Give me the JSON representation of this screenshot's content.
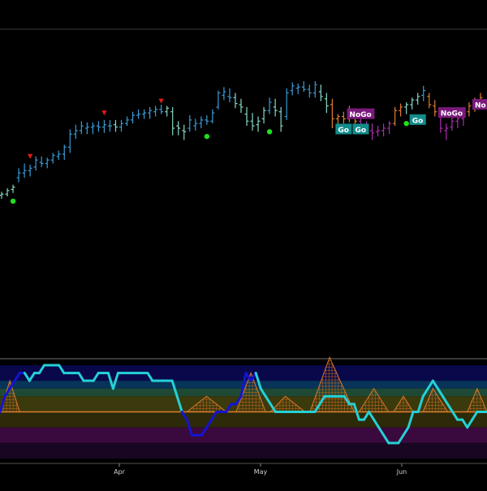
{
  "chart_data": [
    {
      "type": "ohlc",
      "title": "",
      "ylim": [
        0,
        100
      ],
      "colors": {
        "strong_go": "#3a9bd5",
        "weak_go": "#86d9c6",
        "weak_nogo": "#e07c2f",
        "strong_nogo": "#b02ab5",
        "neutral": "#d9d9d9"
      },
      "bars": [
        {
          "x": 0,
          "o": 3,
          "h": 6,
          "l": 0,
          "c": 4,
          "s": "weak_go"
        },
        {
          "x": 1,
          "o": 4,
          "h": 9,
          "l": 2,
          "c": 7,
          "s": "weak_go"
        },
        {
          "x": 2,
          "o": 8,
          "h": 12,
          "l": 5,
          "c": 10,
          "s": "weak_go"
        },
        {
          "x": 3,
          "o": 18,
          "h": 26,
          "l": 14,
          "c": 22,
          "s": "strong_go"
        },
        {
          "x": 4,
          "o": 22,
          "h": 30,
          "l": 18,
          "c": 24,
          "s": "strong_go"
        },
        {
          "x": 5,
          "o": 24,
          "h": 29,
          "l": 19,
          "c": 26,
          "s": "strong_go"
        },
        {
          "x": 6,
          "o": 27,
          "h": 36,
          "l": 24,
          "c": 33,
          "s": "strong_go"
        },
        {
          "x": 7,
          "o": 31,
          "h": 36,
          "l": 27,
          "c": 30,
          "s": "strong_go"
        },
        {
          "x": 8,
          "o": 30,
          "h": 35,
          "l": 26,
          "c": 33,
          "s": "strong_go"
        },
        {
          "x": 9,
          "o": 33,
          "h": 39,
          "l": 30,
          "c": 37,
          "s": "strong_go"
        },
        {
          "x": 10,
          "o": 36,
          "h": 41,
          "l": 33,
          "c": 38,
          "s": "strong_go"
        },
        {
          "x": 11,
          "o": 38,
          "h": 46,
          "l": 33,
          "c": 44,
          "s": "strong_go"
        },
        {
          "x": 12,
          "o": 44,
          "h": 59,
          "l": 39,
          "c": 55,
          "s": "strong_go"
        },
        {
          "x": 13,
          "o": 55,
          "h": 63,
          "l": 51,
          "c": 58,
          "s": "strong_go"
        },
        {
          "x": 14,
          "o": 58,
          "h": 66,
          "l": 55,
          "c": 62,
          "s": "strong_go"
        },
        {
          "x": 15,
          "o": 60,
          "h": 65,
          "l": 55,
          "c": 61,
          "s": "strong_go"
        },
        {
          "x": 16,
          "o": 61,
          "h": 65,
          "l": 55,
          "c": 62,
          "s": "strong_go"
        },
        {
          "x": 17,
          "o": 62,
          "h": 66,
          "l": 57,
          "c": 61,
          "s": "strong_go"
        },
        {
          "x": 18,
          "o": 61,
          "h": 67,
          "l": 56,
          "c": 63,
          "s": "strong_go"
        },
        {
          "x": 19,
          "o": 62,
          "h": 67,
          "l": 57,
          "c": 62,
          "s": "strong_go"
        },
        {
          "x": 20,
          "o": 63,
          "h": 67,
          "l": 57,
          "c": 61,
          "s": "weak_go"
        },
        {
          "x": 21,
          "o": 61,
          "h": 67,
          "l": 57,
          "c": 64,
          "s": "strong_go"
        },
        {
          "x": 22,
          "o": 64,
          "h": 70,
          "l": 62,
          "c": 67,
          "s": "strong_go"
        },
        {
          "x": 23,
          "o": 67,
          "h": 74,
          "l": 64,
          "c": 71,
          "s": "strong_go"
        },
        {
          "x": 24,
          "o": 71,
          "h": 76,
          "l": 68,
          "c": 72,
          "s": "strong_go"
        },
        {
          "x": 25,
          "o": 72,
          "h": 76,
          "l": 68,
          "c": 73,
          "s": "strong_go"
        },
        {
          "x": 26,
          "o": 73,
          "h": 78,
          "l": 68,
          "c": 75,
          "s": "strong_go"
        },
        {
          "x": 27,
          "o": 74,
          "h": 79,
          "l": 70,
          "c": 76,
          "s": "strong_go"
        },
        {
          "x": 28,
          "o": 76,
          "h": 80,
          "l": 72,
          "c": 74,
          "s": "strong_go"
        },
        {
          "x": 29,
          "o": 74,
          "h": 79,
          "l": 70,
          "c": 77,
          "s": "weak_go"
        },
        {
          "x": 30,
          "o": 74,
          "h": 78,
          "l": 54,
          "c": 60,
          "s": "weak_go"
        },
        {
          "x": 31,
          "o": 62,
          "h": 66,
          "l": 54,
          "c": 60,
          "s": "weak_go"
        },
        {
          "x": 32,
          "o": 58,
          "h": 63,
          "l": 50,
          "c": 57,
          "s": "weak_go"
        },
        {
          "x": 33,
          "o": 60,
          "h": 71,
          "l": 57,
          "c": 67,
          "s": "strong_go"
        },
        {
          "x": 34,
          "o": 62,
          "h": 68,
          "l": 58,
          "c": 64,
          "s": "strong_go"
        },
        {
          "x": 35,
          "o": 64,
          "h": 70,
          "l": 60,
          "c": 67,
          "s": "strong_go"
        },
        {
          "x": 36,
          "o": 67,
          "h": 71,
          "l": 63,
          "c": 66,
          "s": "strong_go"
        },
        {
          "x": 37,
          "o": 66,
          "h": 76,
          "l": 64,
          "c": 73,
          "s": "strong_go"
        },
        {
          "x": 38,
          "o": 78,
          "h": 92,
          "l": 76,
          "c": 90,
          "s": "strong_go"
        },
        {
          "x": 39,
          "o": 88,
          "h": 95,
          "l": 84,
          "c": 91,
          "s": "strong_go"
        },
        {
          "x": 40,
          "o": 87,
          "h": 94,
          "l": 82,
          "c": 86,
          "s": "strong_go"
        },
        {
          "x": 41,
          "o": 86,
          "h": 90,
          "l": 77,
          "c": 81,
          "s": "weak_go"
        },
        {
          "x": 42,
          "o": 80,
          "h": 85,
          "l": 73,
          "c": 78,
          "s": "weak_go"
        },
        {
          "x": 43,
          "o": 72,
          "h": 78,
          "l": 62,
          "c": 66,
          "s": "weak_go"
        },
        {
          "x": 44,
          "o": 66,
          "h": 73,
          "l": 58,
          "c": 62,
          "s": "weak_go"
        },
        {
          "x": 45,
          "o": 63,
          "h": 70,
          "l": 57,
          "c": 66,
          "s": "weak_go"
        },
        {
          "x": 46,
          "o": 68,
          "h": 78,
          "l": 64,
          "c": 75,
          "s": "weak_go"
        },
        {
          "x": 47,
          "o": 75,
          "h": 86,
          "l": 72,
          "c": 82,
          "s": "strong_go"
        },
        {
          "x": 48,
          "o": 78,
          "h": 85,
          "l": 70,
          "c": 75,
          "s": "weak_go"
        },
        {
          "x": 49,
          "o": 74,
          "h": 78,
          "l": 57,
          "c": 62,
          "s": "weak_go"
        },
        {
          "x": 50,
          "o": 70,
          "h": 94,
          "l": 67,
          "c": 90,
          "s": "strong_go"
        },
        {
          "x": 51,
          "o": 92,
          "h": 99,
          "l": 88,
          "c": 96,
          "s": "strong_go"
        },
        {
          "x": 52,
          "o": 94,
          "h": 98,
          "l": 89,
          "c": 95,
          "s": "strong_go"
        },
        {
          "x": 53,
          "o": 95,
          "h": 100,
          "l": 91,
          "c": 93,
          "s": "strong_go"
        },
        {
          "x": 54,
          "o": 93,
          "h": 97,
          "l": 86,
          "c": 90,
          "s": "strong_go"
        },
        {
          "x": 55,
          "o": 90,
          "h": 100,
          "l": 86,
          "c": 97,
          "s": "strong_go"
        },
        {
          "x": 56,
          "o": 91,
          "h": 97,
          "l": 83,
          "c": 87,
          "s": "weak_go"
        },
        {
          "x": 57,
          "o": 85,
          "h": 90,
          "l": 73,
          "c": 79,
          "s": "weak_go"
        },
        {
          "x": 58,
          "o": 80,
          "h": 85,
          "l": 60,
          "c": 68,
          "s": "weak_nogo"
        },
        {
          "x": 59,
          "o": 68,
          "h": 72,
          "l": 62,
          "c": 70,
          "s": "weak_nogo"
        },
        {
          "x": 60,
          "o": 70,
          "h": 74,
          "l": 64,
          "c": 68,
          "s": "weak_nogo"
        },
        {
          "x": 61,
          "o": 68,
          "h": 79,
          "l": 65,
          "c": 74,
          "s": "weak_nogo"
        },
        {
          "x": 62,
          "o": 72,
          "h": 77,
          "l": 62,
          "c": 66,
          "s": "weak_nogo"
        },
        {
          "x": 63,
          "o": 66,
          "h": 70,
          "l": 56,
          "c": 62,
          "s": "strong_nogo"
        },
        {
          "x": 64,
          "o": 62,
          "h": 66,
          "l": 56,
          "c": 58,
          "s": "strong_nogo"
        },
        {
          "x": 65,
          "o": 58,
          "h": 64,
          "l": 50,
          "c": 56,
          "s": "strong_nogo"
        },
        {
          "x": 66,
          "o": 57,
          "h": 62,
          "l": 53,
          "c": 58,
          "s": "strong_nogo"
        },
        {
          "x": 67,
          "o": 58,
          "h": 64,
          "l": 53,
          "c": 60,
          "s": "strong_nogo"
        },
        {
          "x": 68,
          "o": 60,
          "h": 66,
          "l": 55,
          "c": 64,
          "s": "strong_nogo"
        },
        {
          "x": 69,
          "o": 64,
          "h": 78,
          "l": 62,
          "c": 75,
          "s": "weak_nogo"
        },
        {
          "x": 70,
          "o": 75,
          "h": 81,
          "l": 70,
          "c": 78,
          "s": "weak_nogo"
        },
        {
          "x": 71,
          "o": 78,
          "h": 82,
          "l": 72,
          "c": 80,
          "s": "weak_go"
        },
        {
          "x": 72,
          "o": 80,
          "h": 86,
          "l": 76,
          "c": 84,
          "s": "weak_go"
        },
        {
          "x": 73,
          "o": 84,
          "h": 90,
          "l": 80,
          "c": 87,
          "s": "weak_go"
        },
        {
          "x": 74,
          "o": 88,
          "h": 96,
          "l": 83,
          "c": 92,
          "s": "strong_go"
        },
        {
          "x": 75,
          "o": 87,
          "h": 90,
          "l": 77,
          "c": 80,
          "s": "weak_nogo"
        },
        {
          "x": 76,
          "o": 79,
          "h": 84,
          "l": 70,
          "c": 74,
          "s": "weak_nogo"
        },
        {
          "x": 77,
          "o": 72,
          "h": 76,
          "l": 56,
          "c": 60,
          "s": "strong_nogo"
        },
        {
          "x": 78,
          "o": 58,
          "h": 64,
          "l": 50,
          "c": 60,
          "s": "strong_nogo"
        },
        {
          "x": 79,
          "o": 61,
          "h": 69,
          "l": 58,
          "c": 66,
          "s": "strong_nogo"
        },
        {
          "x": 80,
          "o": 66,
          "h": 72,
          "l": 60,
          "c": 68,
          "s": "strong_nogo"
        },
        {
          "x": 81,
          "o": 68,
          "h": 76,
          "l": 62,
          "c": 72,
          "s": "strong_nogo"
        },
        {
          "x": 82,
          "o": 74,
          "h": 82,
          "l": 70,
          "c": 79,
          "s": "weak_nogo"
        },
        {
          "x": 83,
          "o": 80,
          "h": 86,
          "l": 74,
          "c": 84,
          "s": "weak_nogo"
        },
        {
          "x": 84,
          "o": 84,
          "h": 90,
          "l": 78,
          "c": 86,
          "s": "weak_nogo"
        }
      ],
      "up_markers": [
        {
          "bar": 2,
          "value": -2
        },
        {
          "bar": 36,
          "value": 53
        },
        {
          "bar": 47,
          "value": 57
        },
        {
          "bar": 71,
          "value": 64
        }
      ],
      "down_markers": [
        {
          "bar": 5,
          "value": 36
        },
        {
          "bar": 18,
          "value": 73
        },
        {
          "bar": 28,
          "value": 83
        },
        {
          "bar": 78,
          "value": 73
        }
      ],
      "labels": [
        {
          "bar": 61,
          "value": 72,
          "text": "NoGo",
          "kind": "nogo"
        },
        {
          "bar": 59,
          "value": 59,
          "text": "Go",
          "kind": "go"
        },
        {
          "bar": 62,
          "value": 59,
          "text": "Go",
          "kind": "go"
        },
        {
          "bar": 72,
          "value": 67,
          "text": "Go",
          "kind": "go"
        },
        {
          "bar": 77,
          "value": 73,
          "text": "NoGo",
          "kind": "nogo"
        },
        {
          "bar": 83,
          "value": 80,
          "text": "No",
          "kind": "nogo"
        }
      ]
    },
    {
      "type": "oscillator",
      "ylim": [
        -6,
        6
      ],
      "zero_line": 0,
      "zones": [
        {
          "from": 4,
          "to": 6,
          "color": "#08084a"
        },
        {
          "from": 3,
          "to": 4,
          "color": "#08345a"
        },
        {
          "from": 2,
          "to": 3,
          "color": "#1e4a35"
        },
        {
          "from": 0,
          "to": 2,
          "color": "#3b3a0c"
        },
        {
          "from": -2,
          "to": 0,
          "color": "#2c2a08"
        },
        {
          "from": -4,
          "to": -2,
          "color": "#3a0a3e"
        },
        {
          "from": -6,
          "to": -4,
          "color": "#180622"
        }
      ],
      "line_colors": {
        "bright": "#25d0d6",
        "dark": "#1414d0"
      },
      "values": [
        0,
        2,
        3,
        4,
        5,
        5,
        4,
        5,
        5,
        6,
        6,
        6,
        6,
        5,
        5,
        5,
        5,
        4,
        4,
        4,
        5,
        5,
        5,
        3,
        5,
        5,
        5,
        5,
        5,
        5,
        5,
        4,
        4,
        4,
        4,
        4,
        2,
        0,
        -1,
        -3,
        -3,
        -3,
        -2,
        -1,
        0,
        0,
        0,
        1,
        1,
        2,
        5,
        4,
        5,
        3,
        2,
        1,
        0,
        0,
        0,
        0,
        0,
        0,
        0,
        0,
        0,
        1,
        2,
        2,
        2,
        2,
        2,
        1,
        1,
        -1,
        -1,
        0,
        -1,
        -2,
        -3,
        -4,
        -4,
        -4,
        -3,
        -2,
        0,
        0,
        2,
        3,
        4,
        3,
        2,
        1,
        0,
        -1,
        -1,
        -2,
        -1,
        0,
        0,
        0
      ],
      "segment_colors": "dddddbbbbbbbbbbbbbbbbbbbbbbbbbbbbbbbbdddddddddddddddbbbbbbbbbbbbbbbbbbbbbbbbbbbbbbbbbbbbbbbbbbbbbbbb",
      "histogram": [
        {
          "start": 0,
          "peak": 2,
          "end": 4,
          "height": 4
        },
        {
          "start": 38,
          "peak": 42,
          "end": 46,
          "height": 2
        },
        {
          "start": 48,
          "peak": 51,
          "end": 54,
          "height": 5
        },
        {
          "start": 55,
          "peak": 58,
          "end": 62,
          "height": 2
        },
        {
          "start": 63,
          "peak": 67,
          "end": 72,
          "height": 7
        },
        {
          "start": 73,
          "peak": 76,
          "end": 79,
          "height": 3
        },
        {
          "start": 80,
          "peak": 82,
          "end": 84,
          "height": 2
        },
        {
          "start": 86,
          "peak": 88,
          "end": 91,
          "height": 3
        },
        {
          "start": 95,
          "peak": 97,
          "end": 99,
          "height": 3
        }
      ],
      "x_ticks": [
        "Apr",
        "May",
        "Jun"
      ],
      "x_tick_positions": [
        0.245,
        0.535,
        0.825
      ]
    }
  ]
}
